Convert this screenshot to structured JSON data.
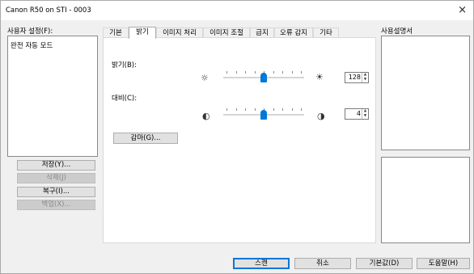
{
  "window": {
    "title": "Canon R50 on STI - 0003",
    "close_glyph": "×"
  },
  "user_settings": {
    "label": "사용자 설정(F):",
    "items": [
      "완전 자동 모드"
    ],
    "buttons": {
      "save": "저장(Y)...",
      "delete": "삭제(J)",
      "restore": "복구(I)...",
      "backup": "백업(X)..."
    }
  },
  "tabs": [
    "기본",
    "밝기",
    "이미지 처리",
    "이미지 조절",
    "급지",
    "오류 감지",
    "기타"
  ],
  "active_tab": "밝기",
  "brightness": {
    "label": "밝기(B):",
    "value": "128",
    "min": 1,
    "max": 255,
    "level": 0.5,
    "low_icon": "☼",
    "high_icon": "☀"
  },
  "contrast": {
    "label": "대비(C):",
    "value": "4",
    "level": 0.5,
    "low_icon": "◐",
    "high_icon": "◑"
  },
  "gamma_button": "감마(G)...",
  "manual_label": "사용설명서",
  "footer": {
    "scan": "스캔",
    "cancel": "취소",
    "defaults": "기본값(D)",
    "help": "도움말(H)"
  },
  "spin_arrows": {
    "up": "▲",
    "down": "▼"
  }
}
